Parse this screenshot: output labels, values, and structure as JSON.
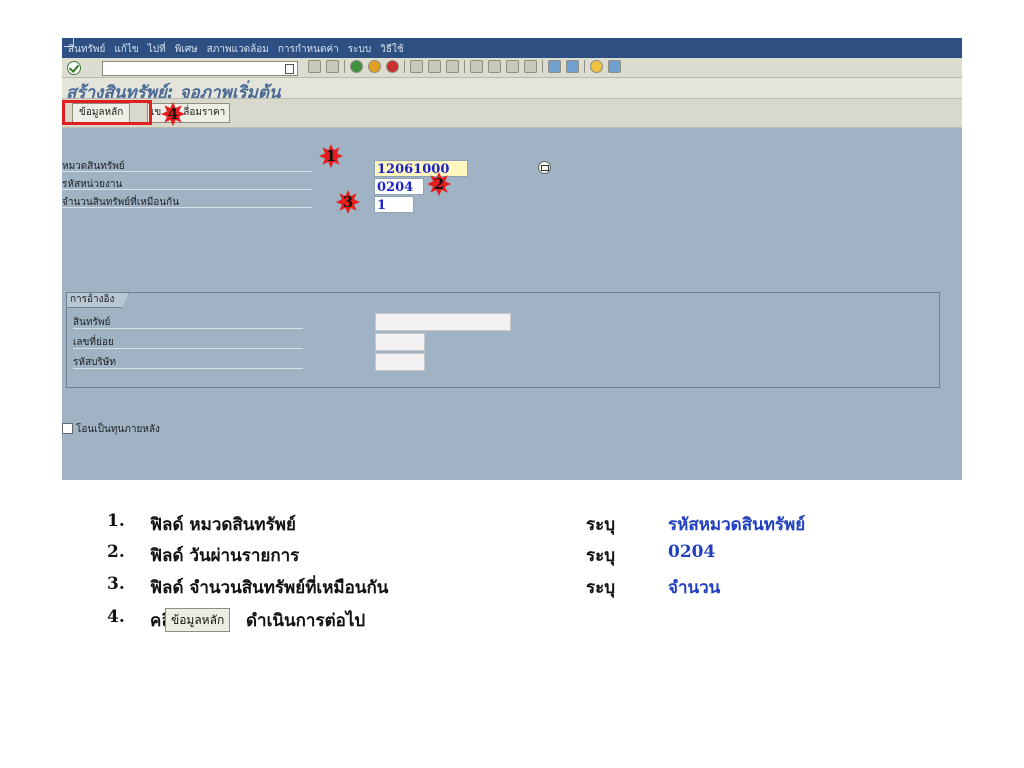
{
  "menu": [
    "สินทรัพย์",
    "แก้ไข",
    "ไปที่",
    "พิเศษ",
    "สภาพแวดล้อม",
    "การกำหนดค่า",
    "ระบบ",
    "วิธีใช้"
  ],
  "title": "สร้างสินทรัพย์: จอภาพเริ่มต้น",
  "app_toolbar": {
    "master_data_btn": "ข้อมูลหลัก",
    "second_btn_prefix": "เข",
    "third_btn": "ลื่อมราคา"
  },
  "fields": {
    "asset_class_label": "หมวดสินทรัพย์",
    "asset_class_value": "12061000",
    "company_code_label": "รหัสหน่วยงาน",
    "company_code_value": "0204",
    "similar_assets_label": "จำนวนสินทรัพย์ที่เหมือนกัน",
    "similar_assets_value": "1"
  },
  "reference_group": {
    "title": "การอ้างอิง",
    "asset_label": "สินทรัพย์",
    "subnumber_label": "เลขที่ย่อย",
    "company_label": "รหัสบริษัท"
  },
  "checkbox_label": "โอนเป็นทุนภายหลัง",
  "markers": [
    "1",
    "2",
    "3",
    "4"
  ],
  "instructions": [
    {
      "num": "1.",
      "text": "ฟิลด์ หมวดสินทรัพย์",
      "verb": "ระบุ",
      "value": "รหัสหมวดสินทรัพย์"
    },
    {
      "num": "2.",
      "text": "ฟิลด์ วันผ่านรายการ",
      "verb": "ระบุ",
      "value": "0204"
    },
    {
      "num": "3.",
      "text": "ฟิลด์ จำนวนสินทรัพย์ที่เหมือนกัน",
      "verb": "ระบุ",
      "value": "จำนวน"
    },
    {
      "num": "4.",
      "text_pre": "คลิก",
      "button": "ข้อมูลหลัก",
      "text_post": "ดำเนินการต่อไป"
    }
  ],
  "colors": {
    "menubar": "#2d4f82",
    "screen_bg": "#9fb3c4",
    "highlight": "#e02020",
    "value_blue": "#2040c0"
  }
}
